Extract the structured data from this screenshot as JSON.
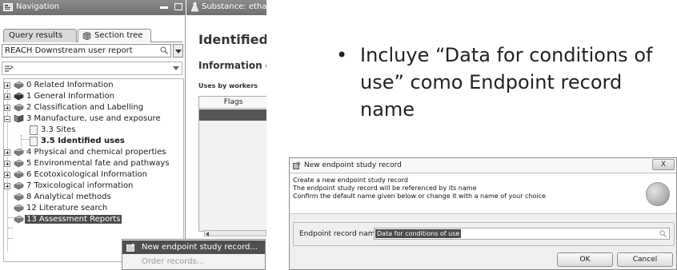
{
  "navigation": {
    "title": "Navigation",
    "tabs": [
      {
        "label": "Query results"
      },
      {
        "label": "Section tree"
      }
    ],
    "report_select": {
      "value": "REACH Downstream user report"
    },
    "tree": [
      {
        "label": "0 Related Information",
        "expander": "plus"
      },
      {
        "label": "1 General Information",
        "expander": "plus"
      },
      {
        "label": "2 Classification and Labelling",
        "expander": "plus"
      },
      {
        "label": "3 Manufacture, use and exposure",
        "expander": "minus"
      },
      {
        "label": "3.3 Sites",
        "child": true
      },
      {
        "label": "3.5 Identified uses",
        "child": true,
        "bold": true
      },
      {
        "label": "4 Physical and chemical properties",
        "expander": "plus"
      },
      {
        "label": "5 Environmental fate and pathways",
        "expander": "plus"
      },
      {
        "label": "6 Ecotoxicological Information",
        "expander": "plus"
      },
      {
        "label": "7 Toxicological information",
        "expander": "plus"
      },
      {
        "label": "8 Analytical methods"
      },
      {
        "label": "12 Literature search"
      },
      {
        "label": "13 Assessment Reports",
        "selected": true
      }
    ]
  },
  "substance_panel": {
    "title": "Substance: etha",
    "heading": "Identified",
    "subheading": "Information o",
    "section_label": "Uses by workers",
    "grid_header": "Flags"
  },
  "context_menu": {
    "items": [
      {
        "label": "New endpoint study record...",
        "highlighted": true
      },
      {
        "label": "Order records...",
        "disabled": true
      }
    ]
  },
  "bullet": {
    "symbol": "•",
    "text": "Incluye “Data for conditions of use” como Endpoint record name"
  },
  "dialog": {
    "title": "New endpoint study record",
    "close_label": "X",
    "info_lines": [
      "Create a new endpoint study record",
      "The endpoint study record will be referenced by its name",
      "Confirm the default name given below or change it with a name of your choice"
    ],
    "field_label": "Endpoint record name",
    "field_value": "Data for conditions of use",
    "ok_label": "OK",
    "cancel_label": "Cancel"
  }
}
